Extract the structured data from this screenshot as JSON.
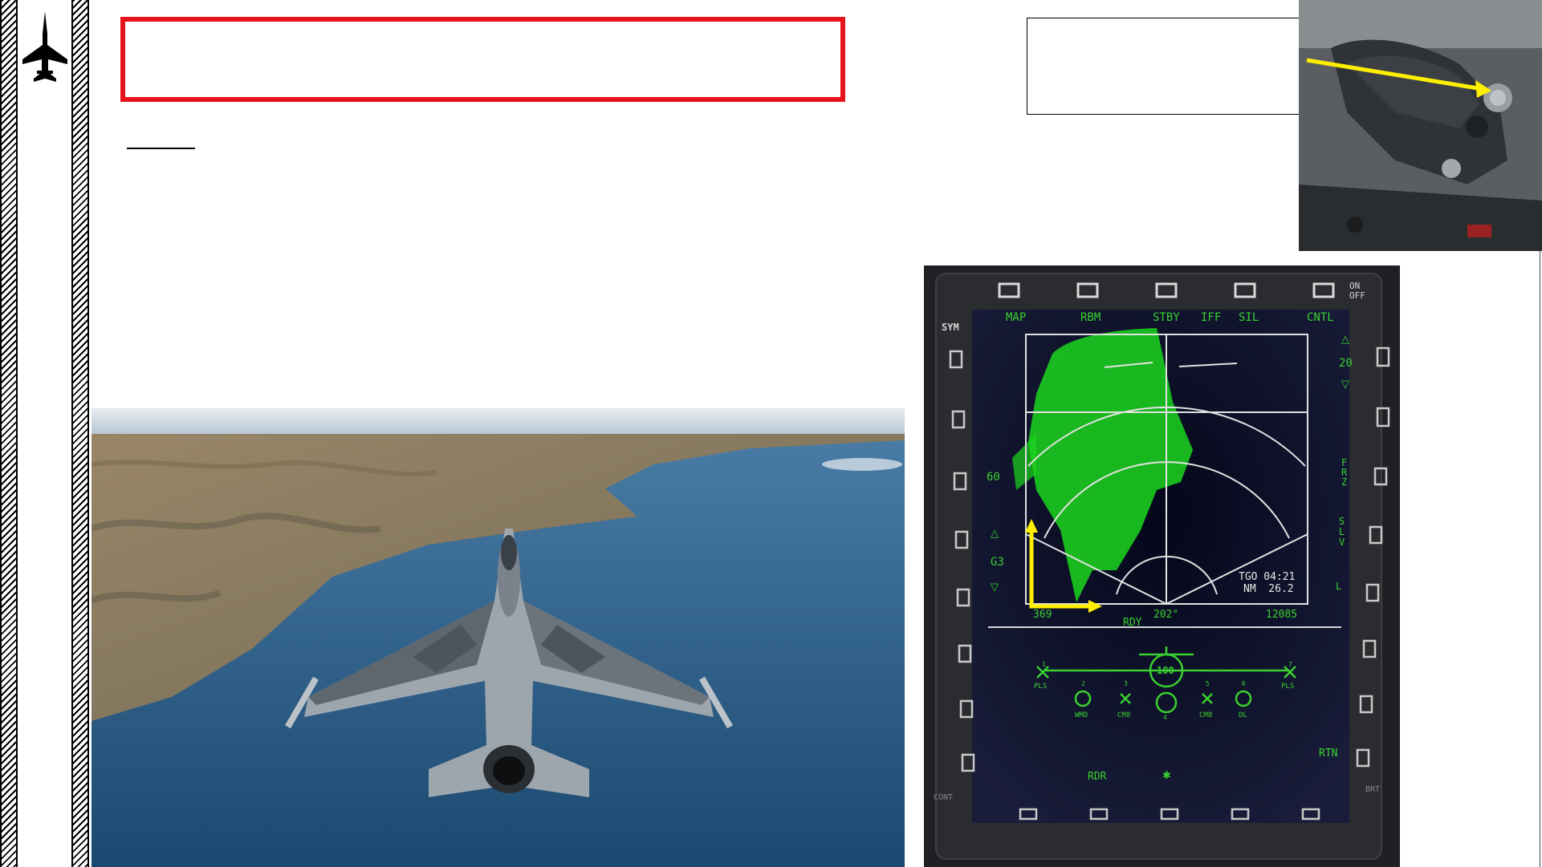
{
  "slide": {
    "title": "",
    "subtitle": "",
    "note": ""
  },
  "mfd": {
    "top_labels": [
      "MAP",
      "RBM",
      "STBY",
      "IFF",
      "SIL",
      "CNTL"
    ],
    "left_labels": [
      "60",
      "G3"
    ],
    "right_labels": [
      "20",
      "FRZ",
      "SLV",
      "L",
      "RTN"
    ],
    "bottom_row": {
      "left": "369",
      "center_left": "RDY",
      "center": "202°",
      "right": "12085"
    },
    "tgo_line": "TGO 04:21",
    "nm_line": "NM  26.2",
    "speed": "100",
    "stores": [
      "PLS",
      "WMD",
      "CM8",
      "CM8",
      "DL",
      "PLS"
    ],
    "stores_numbers": [
      "1",
      "2",
      "3",
      "4",
      "5",
      "6",
      "7"
    ],
    "bottom_label": "RDR",
    "sym_label": "SYM",
    "on_off_label": "ON\nOFF",
    "cont_label": "CONT",
    "brt_label": "BRT"
  },
  "colors": {
    "title_border": "#e8121a",
    "annotation_arrow": "#ffef00",
    "mfd_text": "#39d12f",
    "radar_return": "#1cd61e"
  },
  "icons": [
    "fighter-jet-icon",
    "yellow-arrow"
  ]
}
